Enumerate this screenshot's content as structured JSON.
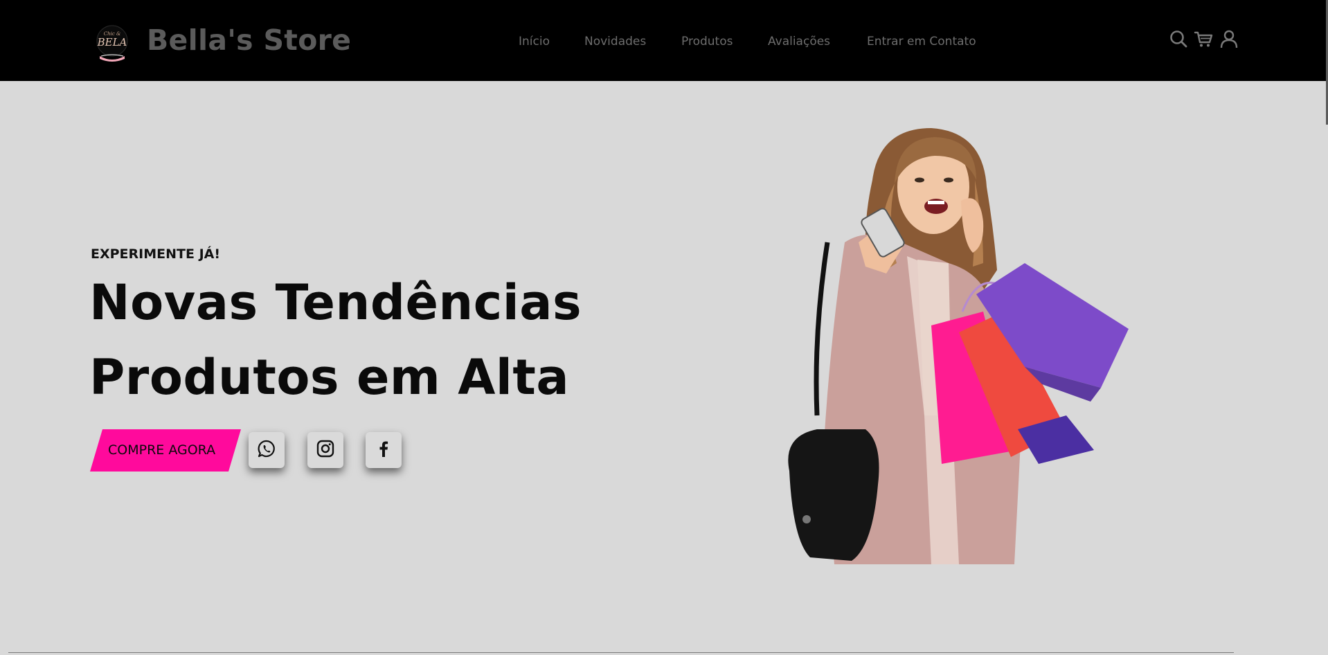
{
  "header": {
    "brand": "Bella's Store",
    "logo_icon": "bella-logo",
    "nav": [
      {
        "label": "Início"
      },
      {
        "label": "Novidades"
      },
      {
        "label": "Produtos"
      },
      {
        "label": "Avaliações"
      },
      {
        "label": "Entrar em Contato"
      }
    ],
    "icons": [
      "search-icon",
      "cart-icon",
      "user-icon"
    ]
  },
  "hero": {
    "eyebrow": "EXPERIMENTE JÁ!",
    "headline_line1": "Novas Tendências",
    "headline_line2": "Produtos em Alta",
    "cta_label": "COMPRE AGORA",
    "social": [
      "whatsapp-icon",
      "instagram-icon",
      "facebook-icon"
    ],
    "image": "woman-with-shopping-bags"
  },
  "colors": {
    "header_bg": "#000000",
    "page_bg": "#d9d9d9",
    "accent": "#ff0a9c",
    "nav_text": "#6d6d6d"
  }
}
